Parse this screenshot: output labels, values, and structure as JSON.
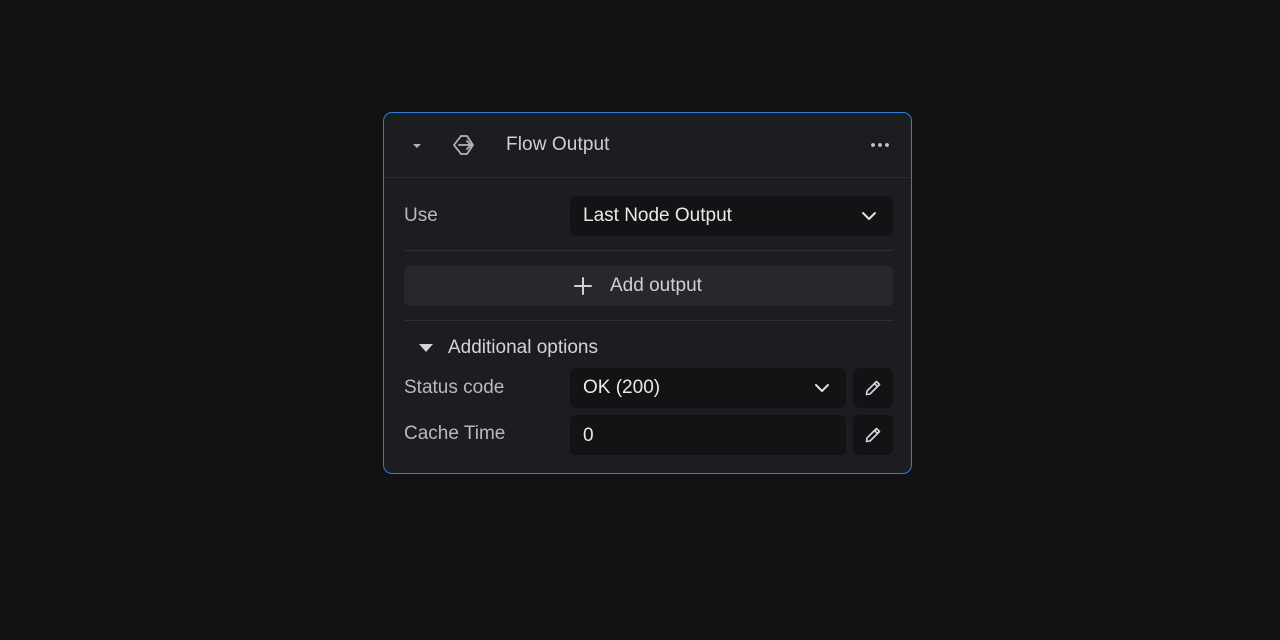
{
  "node": {
    "title": "Flow Output",
    "icon": "flow-output-icon",
    "menu_icon": "more-horizontal-icon"
  },
  "use": {
    "label": "Use",
    "selected": "Last Node Output"
  },
  "add_output": {
    "label": "Add output"
  },
  "additional_options": {
    "label": "Additional options",
    "expanded": true,
    "status_code": {
      "label": "Status code",
      "selected": "OK (200)"
    },
    "cache_time": {
      "label": "Cache Time",
      "value": "0"
    }
  },
  "colors": {
    "accent": "#2f7fd1",
    "background": "#111214",
    "panel": "#1c1d20"
  }
}
